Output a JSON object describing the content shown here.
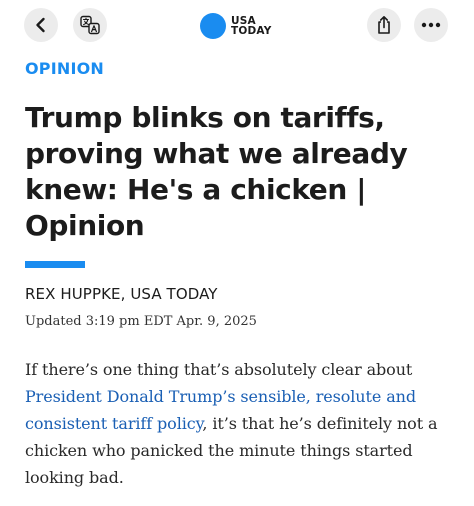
{
  "nav": {
    "back_icon": "chevron-left-icon",
    "translate_icon": "translate-icon",
    "share_icon": "share-icon",
    "more_icon": "more-horizontal-icon",
    "logo_line1": "USA",
    "logo_line2": "TODAY",
    "logo_color": "#1a8cf0"
  },
  "article": {
    "section": "OPINION",
    "headline": "Trump blinks on tariffs, proving what we already knew: He's a chicken | Opinion",
    "byline": "REX HUPPKE, USA TODAY",
    "updated": "Updated 3:19 pm EDT Apr. 9, 2025",
    "body_lead": "If there’s one thing that’s absolutely clear about ",
    "body_link": "President Donald Trump’s sensible, resolute and consistent tariff policy",
    "body_tail": ", it’s that he’s definitely not a chicken who panicked the minute things started looking bad."
  },
  "colors": {
    "accent": "#1a8cf0",
    "link": "#1a5fb4",
    "button_bg": "#ececec"
  }
}
